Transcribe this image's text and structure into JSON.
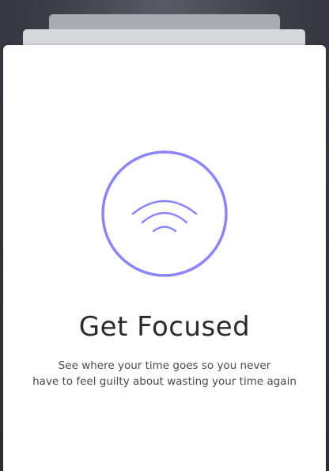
{
  "onboarding": {
    "title": "Get Focused",
    "description_line1": "See where your time goes so you never",
    "description_line2": "have to feel guilty about wasting your time again",
    "icon": "wifi-signal-icon",
    "accent_color": "#8a85ff"
  }
}
